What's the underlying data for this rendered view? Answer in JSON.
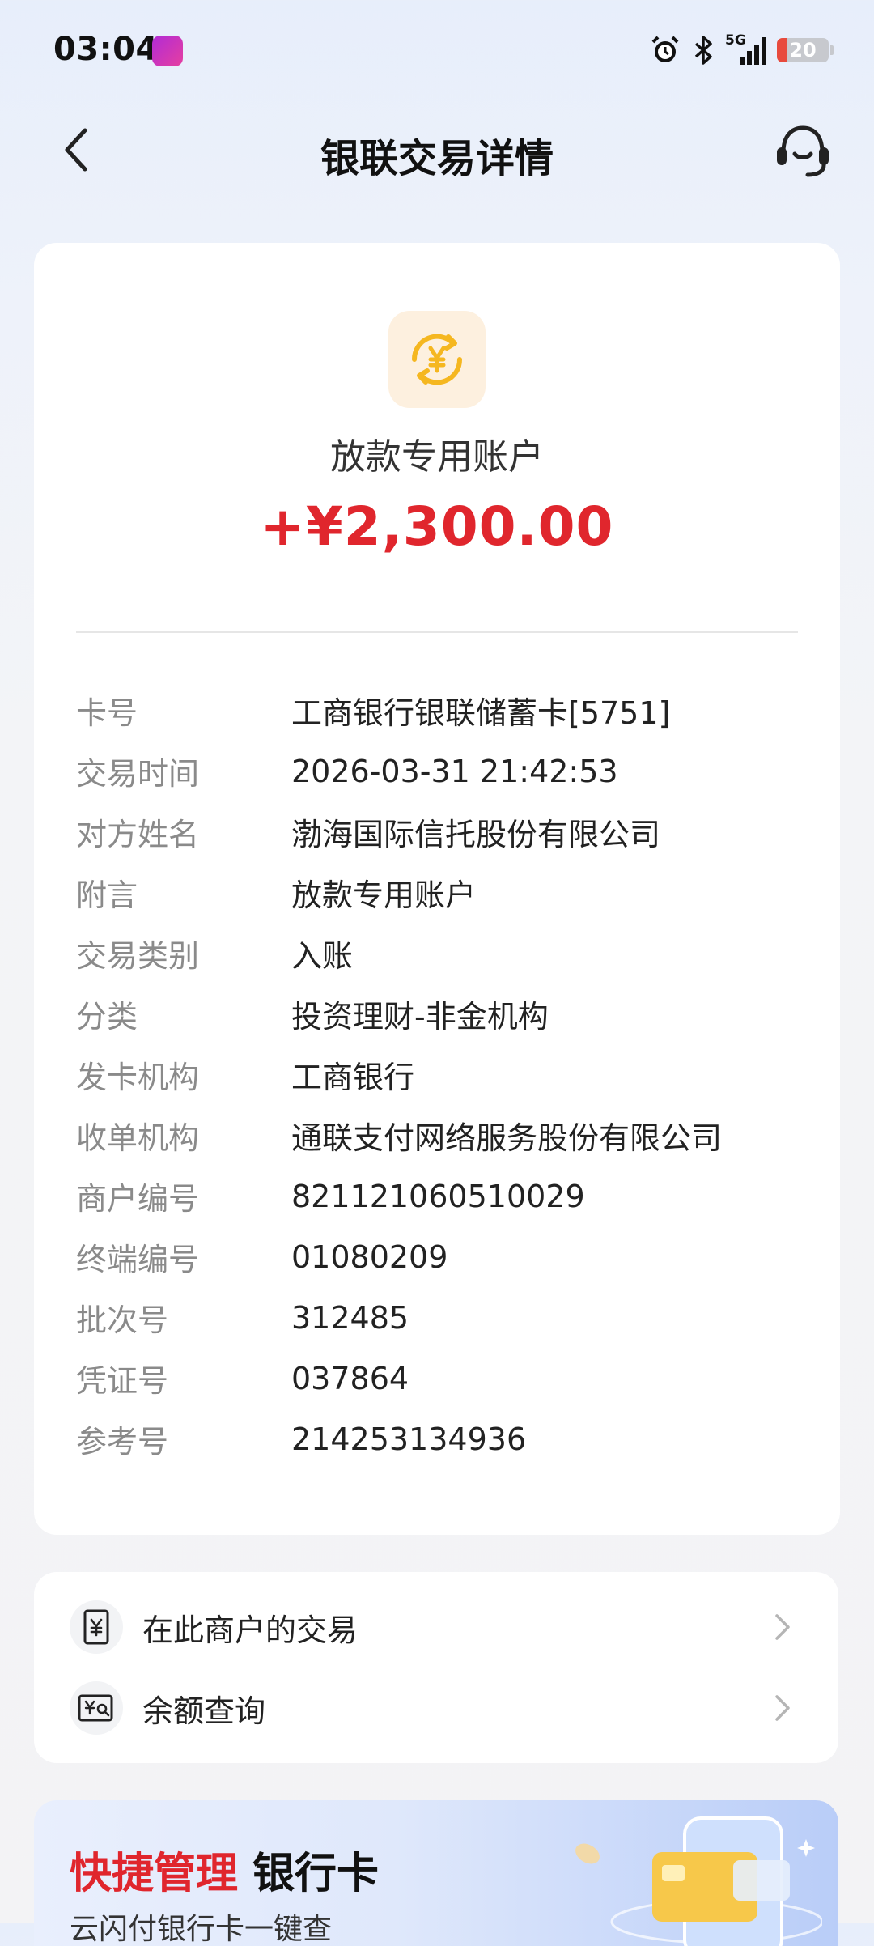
{
  "status_bar": {
    "time": "03:04",
    "network": "5G",
    "battery": "20"
  },
  "header": {
    "title": "银联交易详情"
  },
  "summary": {
    "account_name": "放款专用账户",
    "amount": "+¥2,300.00",
    "amount_color": "#e0262d"
  },
  "details": [
    {
      "label": "卡号",
      "value": "工商银行银联储蓄卡[5751]"
    },
    {
      "label": "交易时间",
      "value": "2026-03-31 21:42:53"
    },
    {
      "label": "对方姓名",
      "value": "渤海国际信托股份有限公司"
    },
    {
      "label": "附言",
      "value": "放款专用账户"
    },
    {
      "label": "交易类别",
      "value": "入账"
    },
    {
      "label": "分类",
      "value": "投资理财-非金机构"
    },
    {
      "label": "发卡机构",
      "value": "工商银行"
    },
    {
      "label": "收单机构",
      "value": "通联支付网络服务股份有限公司"
    },
    {
      "label": "商户编号",
      "value": "821121060510029"
    },
    {
      "label": "终端编号",
      "value": "01080209"
    },
    {
      "label": "批次号",
      "value": "312485"
    },
    {
      "label": "凭证号",
      "value": "037864"
    },
    {
      "label": "参考号",
      "value": "214253134936"
    }
  ],
  "actions": [
    {
      "label": "在此商户的交易",
      "icon": "receipt-icon"
    },
    {
      "label": "余额查询",
      "icon": "balance-search-icon"
    }
  ],
  "promo": {
    "title_red": "快捷管理",
    "title_dark": "银行卡",
    "subtitle": "云闪付银行卡一键查"
  }
}
